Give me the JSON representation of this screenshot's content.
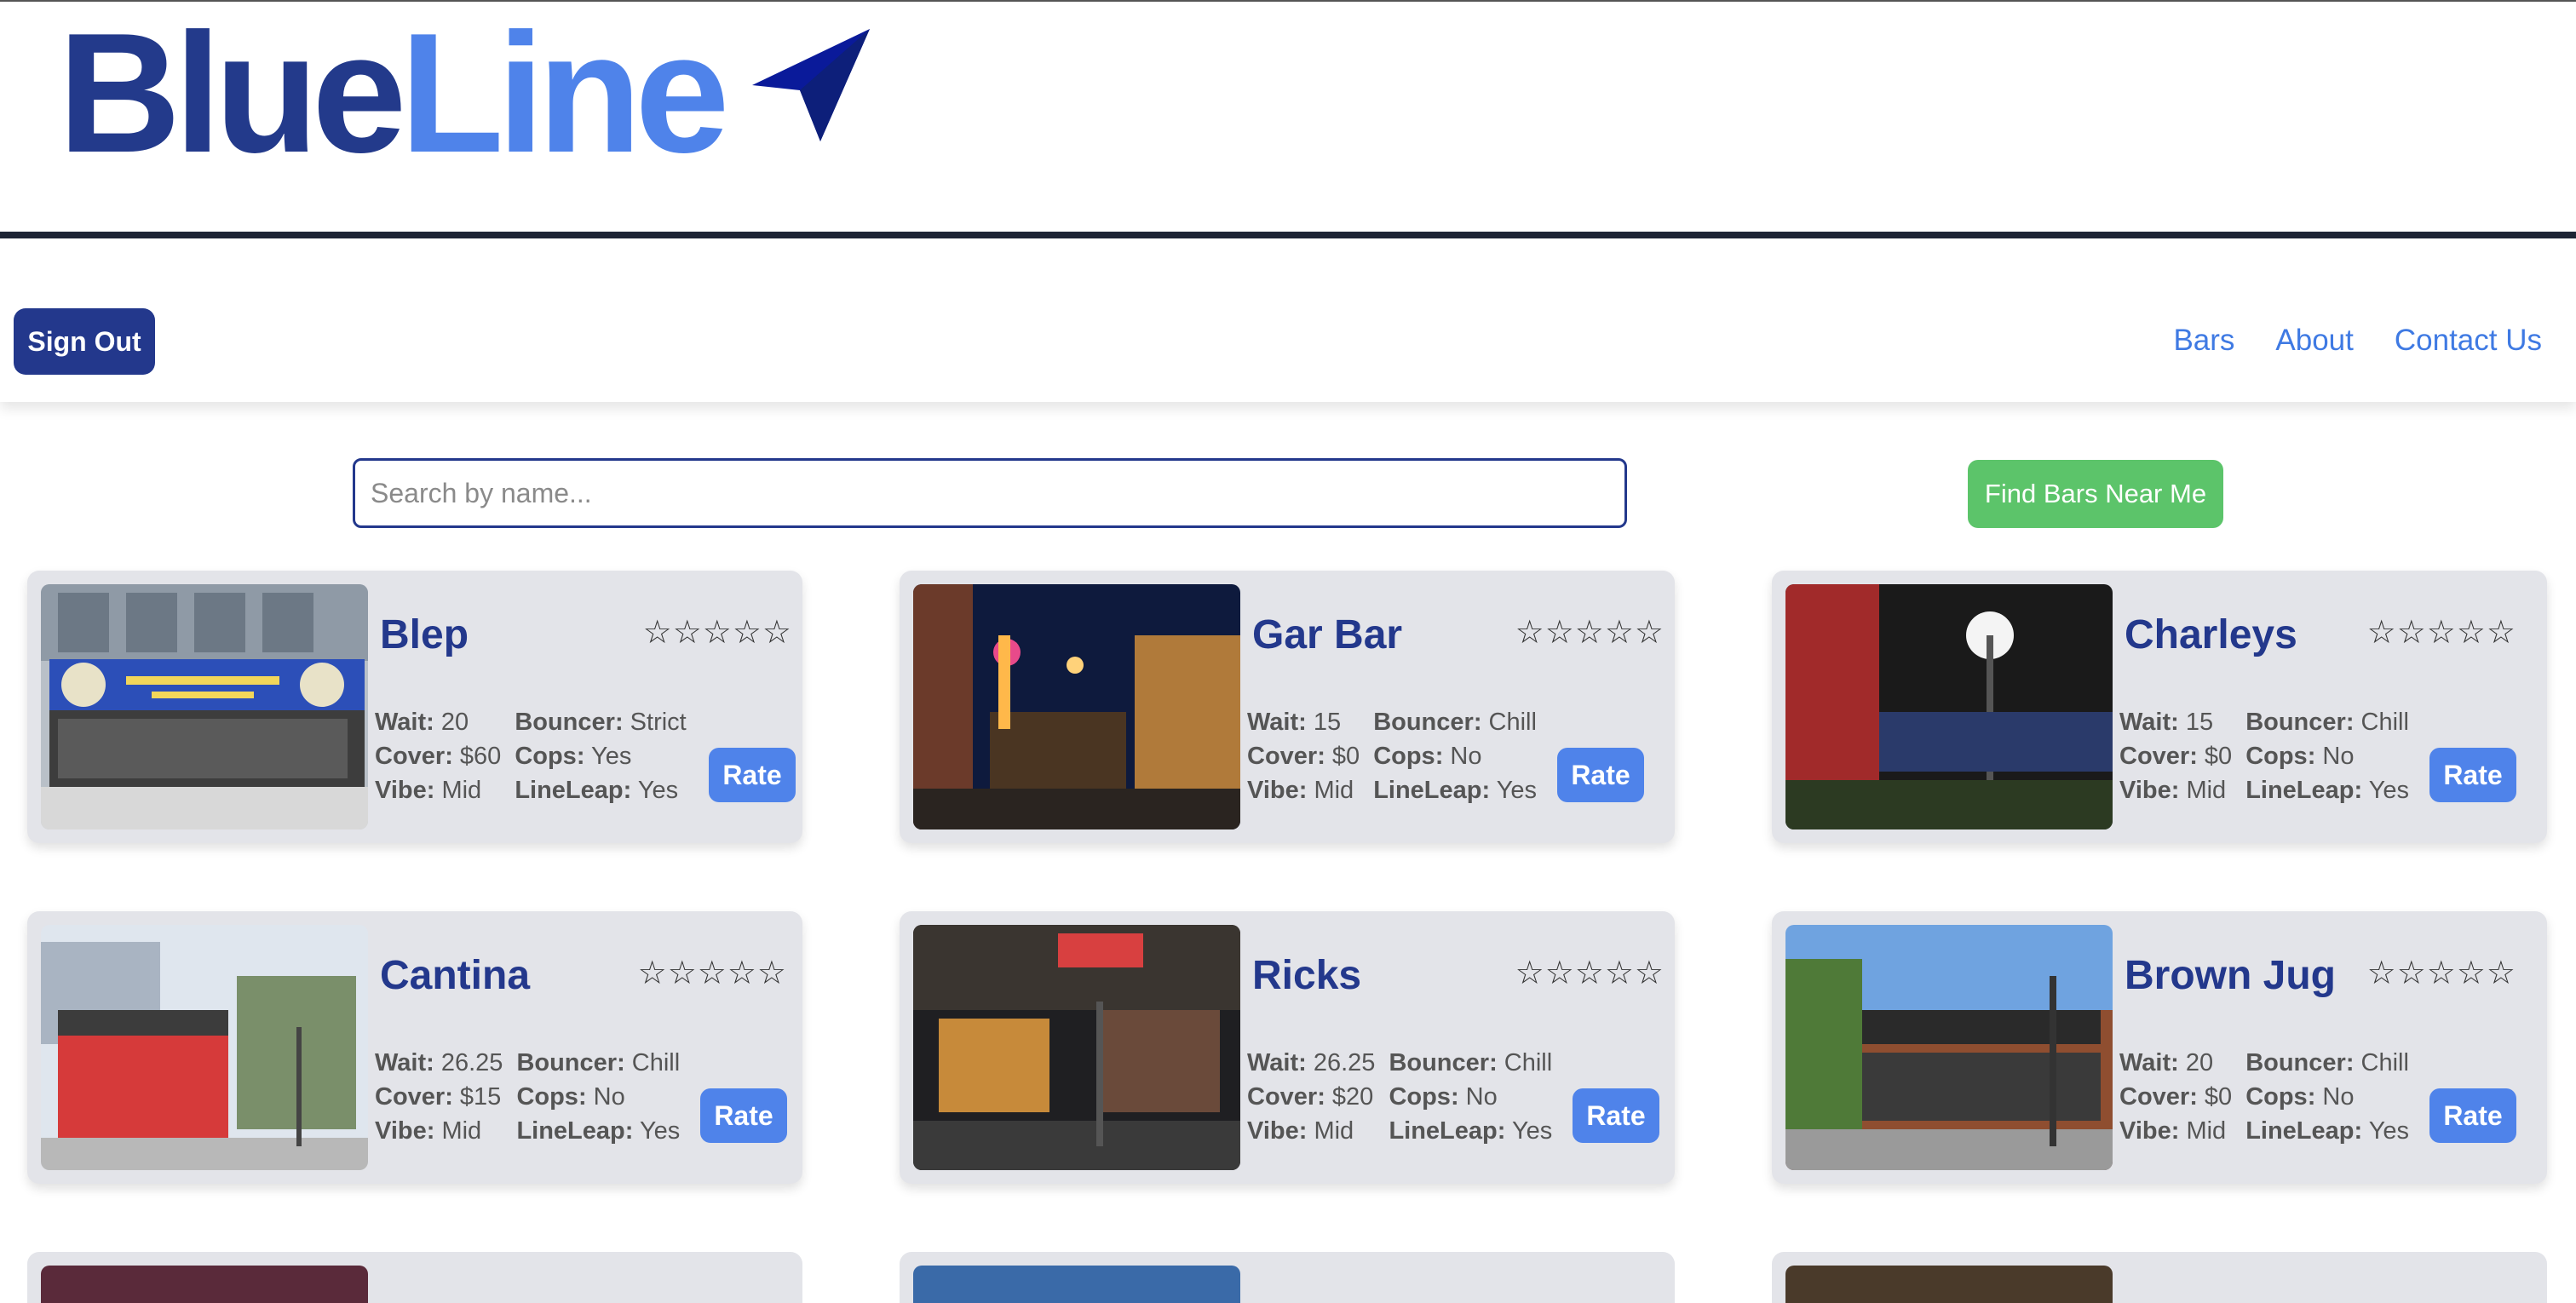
{
  "logo": {
    "part1": "Blue",
    "part2": "Line",
    "icon": "paper-plane-icon"
  },
  "nav": {
    "signout_label": "Sign Out",
    "links": [
      "Bars",
      "About",
      "Contact Us"
    ]
  },
  "search": {
    "placeholder": "Search by name...",
    "value": "",
    "find_label": "Find Bars Near Me"
  },
  "labels": {
    "wait": "Wait:",
    "cover": "Cover:",
    "vibe": "Vibe:",
    "bouncer": "Bouncer:",
    "cops": "Cops:",
    "lineleap": "LineLeap:",
    "rate": "Rate",
    "stars": "☆☆☆☆☆"
  },
  "bars": [
    {
      "name": "Blep",
      "wait": "20",
      "cover": "$60",
      "vibe": "Mid",
      "bouncer": "Strict",
      "cops": "Yes",
      "lineleap": "Yes"
    },
    {
      "name": "Gar Bar",
      "wait": "15",
      "cover": "$0",
      "vibe": "Mid",
      "bouncer": "Chill",
      "cops": "No",
      "lineleap": "Yes"
    },
    {
      "name": "Charleys",
      "wait": "15",
      "cover": "$0",
      "vibe": "Mid",
      "bouncer": "Chill",
      "cops": "No",
      "lineleap": "Yes"
    },
    {
      "name": "Cantina",
      "wait": "26.25",
      "cover": "$15",
      "vibe": "Mid",
      "bouncer": "Chill",
      "cops": "No",
      "lineleap": "Yes"
    },
    {
      "name": "Ricks",
      "wait": "26.25",
      "cover": "$20",
      "vibe": "Mid",
      "bouncer": "Chill",
      "cops": "No",
      "lineleap": "Yes"
    },
    {
      "name": "Brown Jug",
      "wait": "20",
      "cover": "$0",
      "vibe": "Mid",
      "bouncer": "Chill",
      "cops": "No",
      "lineleap": "Yes"
    }
  ]
}
